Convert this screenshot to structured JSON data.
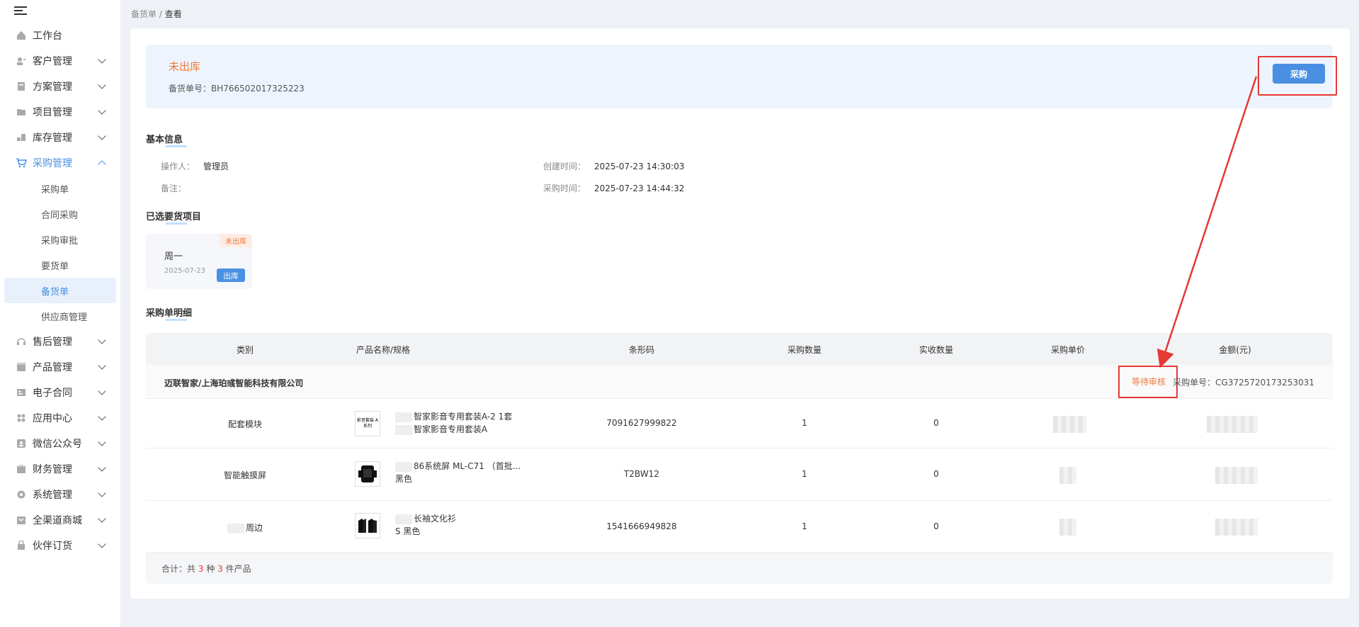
{
  "sidebar": {
    "items": [
      {
        "label": "工作台",
        "icon": "home-icon"
      },
      {
        "label": "客户管理",
        "icon": "user-card-icon"
      },
      {
        "label": "方案管理",
        "icon": "document-icon"
      },
      {
        "label": "项目管理",
        "icon": "folder-icon"
      },
      {
        "label": "库存管理",
        "icon": "boxes-icon"
      },
      {
        "label": "采购管理",
        "icon": "cart-icon"
      }
    ],
    "sub_items": [
      "采购单",
      "合同采购",
      "采购审批",
      "要货单",
      "备货单",
      "供应商管理"
    ],
    "items_after": [
      {
        "label": "售后管理",
        "icon": "headset-icon"
      },
      {
        "label": "产品管理",
        "icon": "box-icon"
      },
      {
        "label": "电子合同",
        "icon": "contract-icon"
      },
      {
        "label": "应用中心",
        "icon": "apps-icon"
      },
      {
        "label": "微信公众号",
        "icon": "wechat-icon"
      },
      {
        "label": "财务管理",
        "icon": "wallet-icon"
      },
      {
        "label": "系统管理",
        "icon": "settings-icon"
      },
      {
        "label": "全渠道商城",
        "icon": "shop-icon"
      },
      {
        "label": "伙伴订货",
        "icon": "bag-icon"
      }
    ]
  },
  "breadcrumb": {
    "parent": "备货单",
    "sep": "/",
    "current": "查看"
  },
  "status": {
    "text": "未出库",
    "order_label": "备货单号：",
    "order_no": "BH766502017325223",
    "button": "采购"
  },
  "basic": {
    "title": "基本信息",
    "operator_label": "操作人：",
    "operator": "管理员",
    "remark_label": "备注：",
    "created_label": "创建时间：",
    "created": "2025-07-23 14:30:03",
    "purchase_time_label": "采购时间：",
    "purchase_time": "2025-07-23 14:44:32"
  },
  "projects": {
    "title": "已选要货项目",
    "card": {
      "tag": "未出库",
      "name": "周一",
      "date": "2025-07-23",
      "button": "出库"
    }
  },
  "detail": {
    "title": "采购单明细",
    "headers": [
      "类别",
      "产品名称/规格",
      "条形码",
      "采购数量",
      "实收数量",
      "采购单价",
      "金额(元)"
    ],
    "supplier": "迈联智家/上海珀彧智能科技有限公司",
    "pending": "等待审核",
    "po_label": "采购单号：",
    "po_no": "CG3725720173253031",
    "rows": [
      {
        "category": "配套模块",
        "name": "智家影音专用套装A-2 1套",
        "spec": "智家影音专用套装A",
        "barcode": "7091627999822",
        "qty": "1",
        "received": "0",
        "thumb_text": "影音套装 A系列"
      },
      {
        "category": "智能触摸屏",
        "name": "86系统屏 ML-C71 （首批...",
        "spec": "黑色",
        "barcode": "T2BW12",
        "qty": "1",
        "received": "0"
      },
      {
        "category": "周边",
        "name": "长袖文化衫",
        "spec": "S 黑色",
        "barcode": "1541666949828",
        "qty": "1",
        "received": "0"
      }
    ],
    "total_prefix": "合计：共",
    "total_kinds": "3",
    "total_mid": "种",
    "total_items": "3",
    "total_suffix": "件产品"
  },
  "colors": {
    "accent": "#4a90e2",
    "warning": "#f07a3c",
    "highlight": "#e53935"
  }
}
